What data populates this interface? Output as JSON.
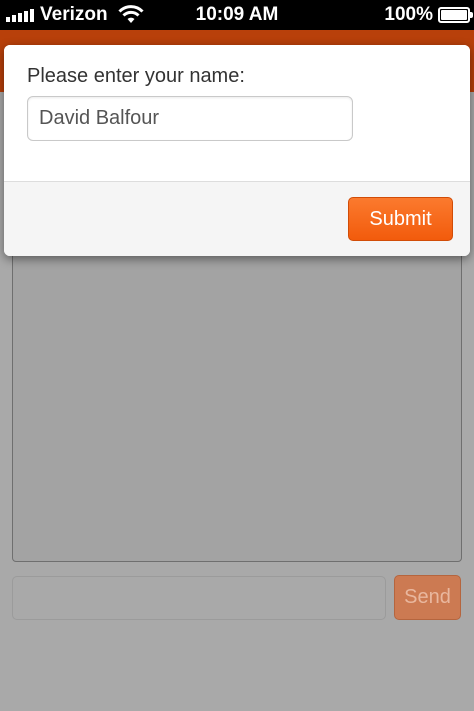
{
  "status_bar": {
    "carrier": "Verizon",
    "time": "10:09 AM",
    "battery_percent": "100%",
    "battery_level": 1.0,
    "signal_icon": "signal-bars-icon",
    "wifi_icon": "wifi-icon",
    "battery_icon": "battery-icon"
  },
  "modal": {
    "label": "Please enter your name:",
    "name_value": "David Balfour",
    "submit_label": "Submit"
  },
  "chat": {
    "message_value": "",
    "send_label": "Send"
  },
  "colors": {
    "accent": "#f25b0c",
    "header_dimmed": "#b8400a",
    "overlay": "#a9a9a9"
  }
}
